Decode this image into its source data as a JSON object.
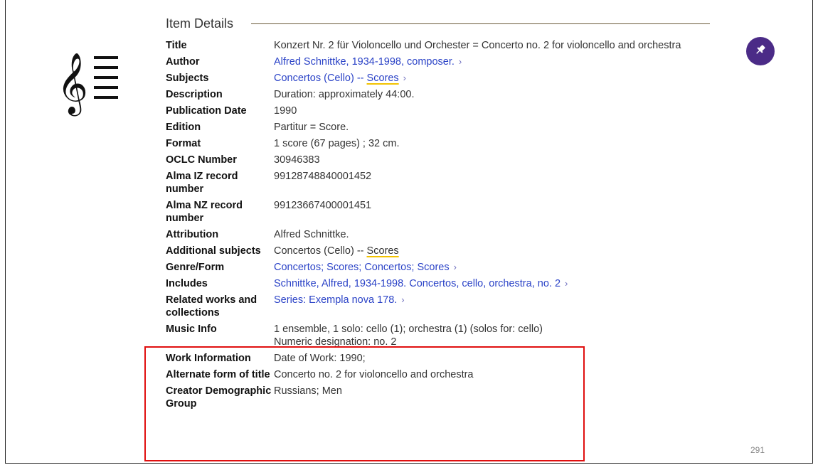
{
  "section": {
    "title": "Item Details"
  },
  "colors": {
    "accent": "#4b2b87",
    "link": "#2b43c7",
    "highlight_border": "#e01010",
    "underline": "#f2c200"
  },
  "icons": {
    "music": "music-score-icon",
    "pin": "pin-icon"
  },
  "fields": {
    "title": {
      "label": "Title",
      "value": "Konzert Nr. 2 für Violoncello und Orchester = Concerto no. 2 for violoncello and orchestra"
    },
    "author": {
      "label": "Author",
      "value": "Alfred Schnittke, 1934-1998, composer."
    },
    "subjects": {
      "label": "Subjects",
      "value_prefix": "Concertos (Cello) -- ",
      "value_highlight": "Scores"
    },
    "description": {
      "label": "Description",
      "value": "Duration: approximately 44:00."
    },
    "publication_date": {
      "label": "Publication Date",
      "value": "1990"
    },
    "edition": {
      "label": "Edition",
      "value": "Partitur = Score."
    },
    "format": {
      "label": "Format",
      "value": "1 score (67 pages) ; 32 cm."
    },
    "oclc": {
      "label": "OCLC Number",
      "value": "30946383"
    },
    "alma_iz": {
      "label": "Alma IZ record number",
      "value": "99128748840001452"
    },
    "alma_nz": {
      "label": "Alma NZ record number",
      "value": "99123667400001451"
    },
    "attribution": {
      "label": "Attribution",
      "value": "Alfred Schnittke."
    },
    "additional_subjects": {
      "label": "Additional subjects",
      "value_prefix": "Concertos (Cello) -- ",
      "value_highlight": "Scores"
    },
    "genre_form": {
      "label": "Genre/Form",
      "value": "Concertos; Scores; Concertos; Scores"
    },
    "includes": {
      "label": "Includes",
      "value": "Schnittke, Alfred, 1934-1998. Concertos, cello, orchestra, no. 2"
    },
    "related": {
      "label": "Related works and collections",
      "value": "Series: Exempla nova 178."
    },
    "music_info": {
      "label": "Music Info",
      "line1": "1 ensemble, 1 solo: cello (1); orchestra (1) (solos for: cello)",
      "line2": "Numeric designation: no. 2"
    },
    "work_info": {
      "label": "Work Information",
      "value": "Date of Work: 1990;"
    },
    "alternate_title": {
      "label": "Alternate form of title",
      "value": "Concerto no. 2 for violoncello and orchestra"
    },
    "creator_demo": {
      "label": "Creator Demographic Group",
      "value": "Russians; Men"
    }
  },
  "chevron": "›",
  "page_number": "291"
}
